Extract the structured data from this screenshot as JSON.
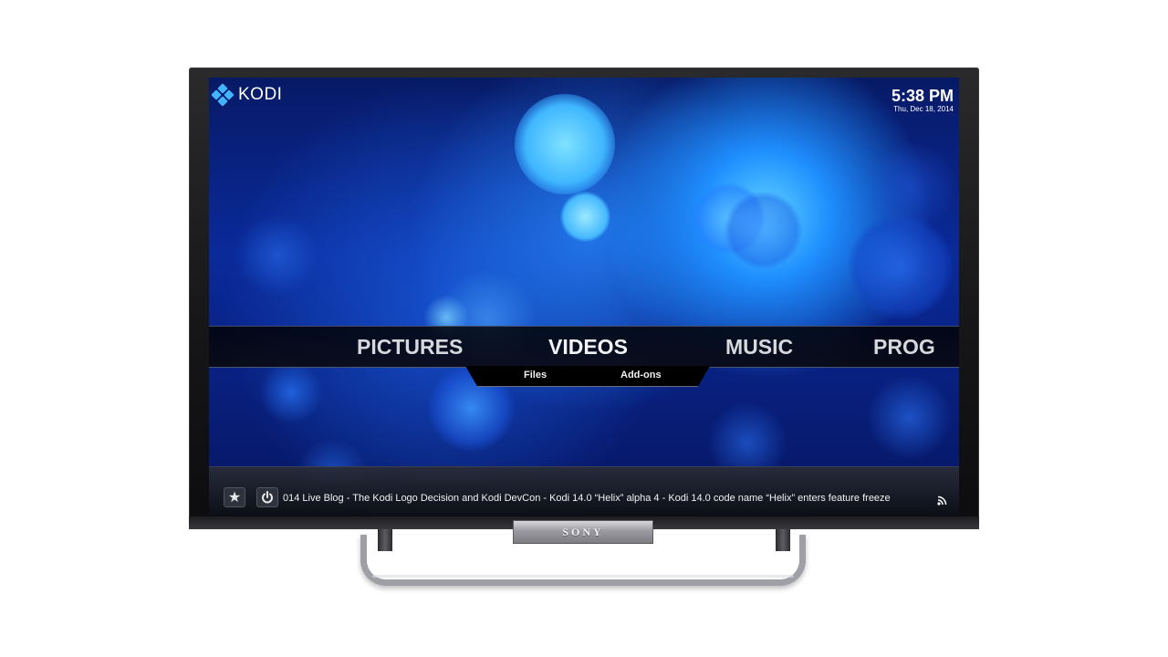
{
  "device": {
    "brand": "SONY"
  },
  "app": {
    "logo_text": "KODI",
    "clock_time": "5:38 PM",
    "clock_date": "Thu, Dec 18, 2014"
  },
  "main_menu": {
    "items": [
      {
        "label": "PICTURES"
      },
      {
        "label": "VIDEOS"
      },
      {
        "label": "MUSIC"
      },
      {
        "label": "PROG"
      }
    ],
    "selected": "VIDEOS"
  },
  "submenu": {
    "items": [
      {
        "label": "Files"
      },
      {
        "label": "Add-ons"
      }
    ]
  },
  "footer": {
    "ticker_text": "014 Live Blog - The Kodi Logo Decision and Kodi DevCon - Kodi 14.0 “Helix” alpha 4 - Kodi 14.0 code name “Helix” enters feature freeze",
    "favourites_icon": "star-icon",
    "power_icon": "power-icon",
    "rss_icon": "rss-icon"
  },
  "colors": {
    "kodi_accent": "#43b5ff",
    "background_blue": "#0a2a9a"
  }
}
